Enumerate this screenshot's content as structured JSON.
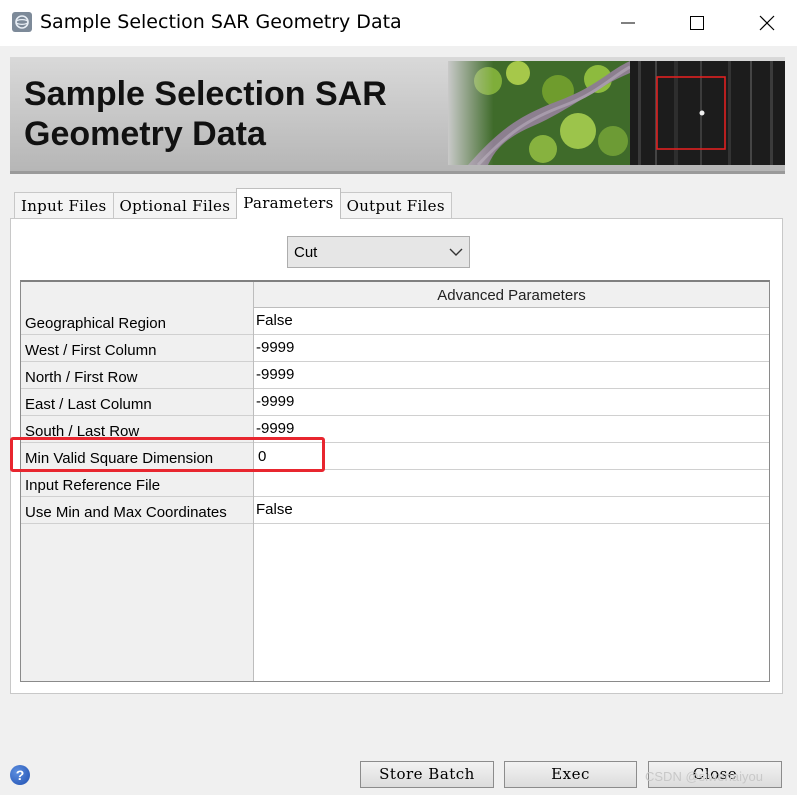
{
  "window": {
    "title": "Sample Selection SAR Geometry Data",
    "controls": [
      "minimize",
      "maximize",
      "close"
    ]
  },
  "banner": {
    "title_line1": "Sample Selection SAR",
    "title_line2": "Geometry Data"
  },
  "tabs": [
    {
      "label": "Input Files",
      "active": false
    },
    {
      "label": "Optional Files",
      "active": false
    },
    {
      "label": "Parameters",
      "active": true
    },
    {
      "label": "Output Files",
      "active": false
    }
  ],
  "mode_select": {
    "value": "Cut"
  },
  "params_table": {
    "header": "Advanced Parameters",
    "rows": [
      {
        "label": "Geographical Region",
        "value": "False"
      },
      {
        "label": "West / First Column",
        "value": "-9999"
      },
      {
        "label": "North / First Row",
        "value": "-9999"
      },
      {
        "label": "East / Last Column",
        "value": "-9999"
      },
      {
        "label": "South / Last Row",
        "value": "-9999"
      },
      {
        "label": "Min Valid Square Dimension",
        "value": "0"
      },
      {
        "label": "Input Reference File",
        "value": ""
      },
      {
        "label": "Use Min and Max Coordinates",
        "value": "False"
      }
    ]
  },
  "buttons": {
    "store_batch": "Store Batch",
    "exec": "Exec",
    "close": "Close"
  },
  "help_icon": "question-icon",
  "watermark": "CSDN @siwenaiyou",
  "colors": {
    "highlight": "#e8262f",
    "header_bg": "#f0f0f0"
  }
}
